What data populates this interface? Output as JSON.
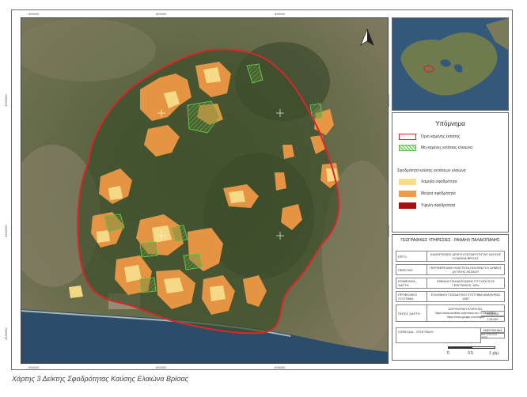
{
  "map": {
    "colors": {
      "burned_boundary": "#d9262b",
      "unburned_olive": "#4caf50",
      "low_severity": "#f7dd8a",
      "medium_severity": "#f39a45",
      "high_severity": "#a60f0f",
      "sea": "#2c4d6a",
      "forest": "#3c4d2c"
    },
    "north_arrow_icon": "north-arrow-icon"
  },
  "ticks": {
    "x": [
      "690000",
      "692500",
      "695000"
    ],
    "y": [
      "4335000",
      "4332500",
      "4330000"
    ]
  },
  "legend": {
    "title": "Υπόμνημα",
    "burned_area": "Όριο καμένης έκτασης",
    "unburned_olive": "Μη καμένες εκτάσεις ελαιώνα",
    "severity_title": "Σφοδρότητα καύσης εκτάσεων ελαιώνα",
    "low": "Χαμηλή σφοδρότητα",
    "medium": "Μέτρια σφοδρότητα",
    "high": "Υψηλή σφοδρότητα"
  },
  "info": {
    "header": "ΓΕΩΓΡΑΦΙΚΕΣ ΥΠΗΡΕΣΙΕΣ - ΡΑΦΑΗΛ ΠΑΛΑΙΟΠΑΝΗΣ",
    "rows": [
      {
        "key": "ΕΡΓΟ:",
        "value": "ΚΑΘΟΡΙΣΜΟΣ ΔΕΙΚΤΗ ΣΦΟΔΡΟΤΗΤΑΣ ΚΑΥΣΗΣ ΕΛΑΙΩΝΑ ΒΡΙΣΑΣ"
      },
      {
        "key": "ΠΕΡΙΟΧΗ:",
        "value": "ΠΕΡΙΦΕΡΕΙΑΚΗ ΕΝΟΤΗΤΑ ΠΟΛΙΧΝΙΤΟΥ ΔΗΜΟΣ ΔΥΤΙΚΗΣ ΛΕΣΒΟΥ"
      },
      {
        "key": "ΕΠΙΜΕΛΕΙΑ ΧΑΡΤΗ:",
        "value": "ΡΑΦΑΗΛ ΠΑΛΑΙΟΠΑΝΗΣ ΠΤΥΧΙΟΥΧΟΣ ΓΕΩΓΡΑΦΟΣ, MSc"
      },
      {
        "key": "ΠΡΟΒΟΛΙΚΟ ΣΥΣΤΗΜΑ:",
        "value": "ΕΛΛΗΝΙΚΟ ΓΕΩΔΑΙΤΙΚΟ ΣΥΣΤΗΜΑ ΑΝΑΦΟΡΑΣ 1987"
      },
      {
        "key": "ΠΗΓΕΣ ΧΑΡΤΗ:",
        "value": "ΔΟΡΥΦΟΡΙΚΗ ΠΛΗΡΩΤΑΣ: https://www.sentinel.copernicus.eu/ ΥΠΟΒΑΘΡΟ: https://www.google.com/maps/"
      }
    ],
    "signature": "ΣΦΡΑΓΙΔΑ - ΥΠΟΓΡΑΦΗ",
    "scale_label": "ΚΛΙΜΑΚΑ",
    "scale_value": "1:25.000",
    "date_label": "ΗΜΕΡΟΜΗΝΙΑ",
    "date_value": "ΑΥΓΟΥΣΤΟΣ 2022",
    "scale_bar": {
      "zero": "0",
      "half": "0.5",
      "one": "1 χλμ."
    }
  },
  "caption": "Χάρτης 3 Δείκτης Σφοδρότητας Καύσης Ελαιώνα Βρίσας"
}
